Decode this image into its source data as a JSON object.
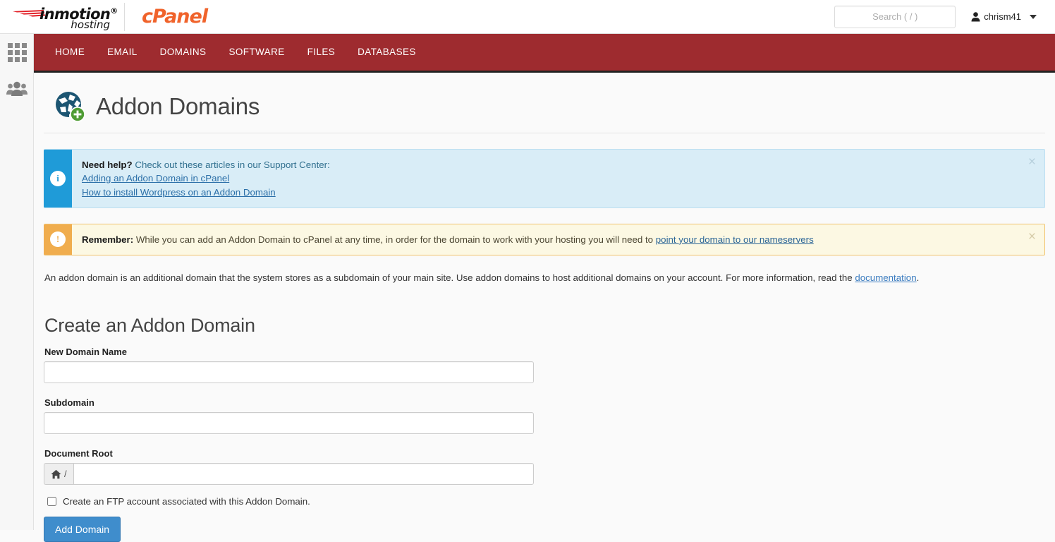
{
  "brand": {
    "inmotion_name": "inmotion",
    "inmotion_registered": "®",
    "inmotion_sub": "hosting",
    "cpanel": "cPanel"
  },
  "header": {
    "search_placeholder": "Search ( / )",
    "search_value": "",
    "username": "chrism41"
  },
  "sidebar": {
    "items": [
      {
        "name": "apps-grid",
        "label": "Apps"
      },
      {
        "name": "user-manager",
        "label": "User Manager"
      }
    ]
  },
  "nav": {
    "items": [
      "HOME",
      "EMAIL",
      "DOMAINS",
      "SOFTWARE",
      "FILES",
      "DATABASES"
    ]
  },
  "page": {
    "title": "Addon Domains"
  },
  "alerts": {
    "info": {
      "badge": "i",
      "bold_lead": "Need help?",
      "text": " Check out these articles in our Support Center:",
      "links": [
        "Adding an Addon Domain in cPanel",
        "How to install Wordpress on an Addon Domain"
      ],
      "close": "×"
    },
    "warning": {
      "badge": "!",
      "bold_lead": "Remember:",
      "text": " While you can add an Addon Domain to cPanel at any time, in order for the domain to work with your hosting you will need to ",
      "link": "point your domain to our nameservers",
      "close": "×"
    }
  },
  "description": {
    "text": "An addon domain is an additional domain that the system stores as a subdomain of your main site. Use addon domains to host additional domains on your account. For more information, read the ",
    "link": "documentation",
    "suffix": "."
  },
  "form": {
    "heading": "Create an Addon Domain",
    "fields": {
      "new_domain": {
        "label": "New Domain Name",
        "value": "",
        "placeholder": ""
      },
      "subdomain": {
        "label": "Subdomain",
        "value": "",
        "placeholder": ""
      },
      "document_root": {
        "label": "Document Root",
        "prefix": "/",
        "value": "",
        "placeholder": ""
      }
    },
    "ftp_checkbox": {
      "label": "Create an FTP account associated with this Addon Domain.",
      "checked": false
    },
    "submit_label": "Add Domain"
  },
  "colors": {
    "nav_red": "#9e2b2f",
    "cpanel_orange": "#f0632b",
    "info_blue": "#1f9bd8",
    "warn_orange": "#f0ad4e",
    "button_blue": "#3f8dcc"
  }
}
